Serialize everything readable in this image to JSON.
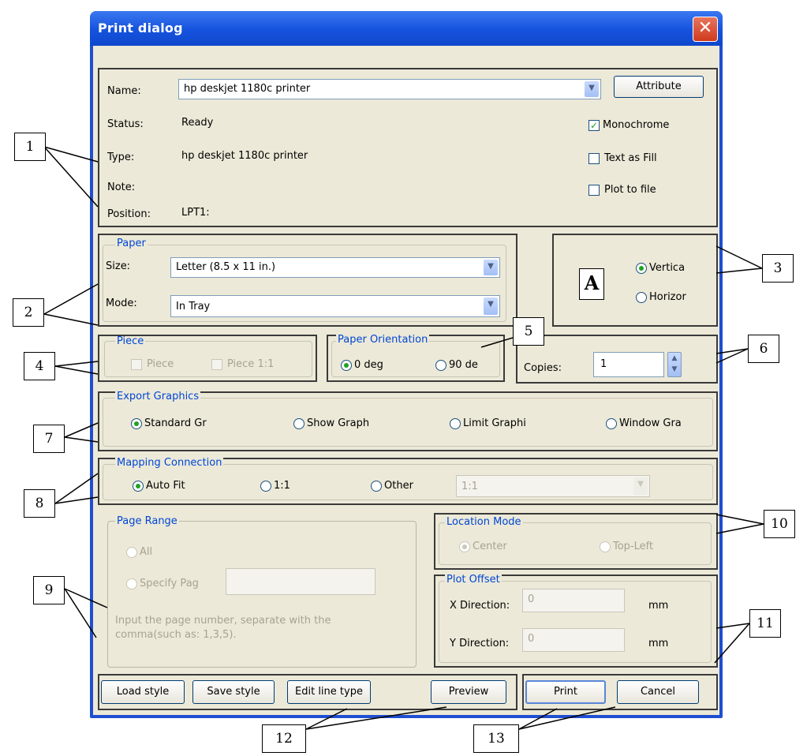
{
  "window": {
    "title": "Print dialog",
    "close_glyph": "✕"
  },
  "printer": {
    "name_label": "Name:",
    "name_value": "hp deskjet 1180c printer",
    "attribute_button": "Attribute",
    "status_label": "Status:",
    "status_value": "Ready",
    "type_label": "Type:",
    "type_value": "hp deskjet 1180c printer",
    "note_label": "Note:",
    "note_value": "",
    "position_label": "Position:",
    "position_value": "LPT1:",
    "monochrome": {
      "label": "Monochrome",
      "checked": true
    },
    "text_as_fill": {
      "label": "Text as Fill",
      "checked": false
    },
    "plot_to_file": {
      "label": "Plot to file",
      "checked": false
    }
  },
  "paper": {
    "legend": "Paper",
    "size_label": "Size:",
    "size_value": "Letter (8.5 x 11 in.)",
    "mode_label": "Mode:",
    "mode_value": "In Tray"
  },
  "orientation_preview": {
    "glyph": "A",
    "vertical": "Vertica",
    "horizontal": "Horizor",
    "selected": "vertical"
  },
  "piece": {
    "legend": "Piece",
    "piece_label": "Piece",
    "piece11_label": "Piece 1:1"
  },
  "paper_orientation": {
    "legend": "Paper Orientation",
    "deg0": "0 deg",
    "deg90": "90 de",
    "selected": "0 deg"
  },
  "copies": {
    "label": "Copies:",
    "value": "1"
  },
  "export_graphics": {
    "legend": "Export Graphics",
    "options": [
      "Standard Gr",
      "Show Graph",
      "Limit Graphi",
      "Window Gra"
    ],
    "selected": "Standard Gr"
  },
  "mapping": {
    "legend": "Mapping Connection",
    "auto_fit": "Auto Fit",
    "one_to_one": "1:1",
    "other": "Other",
    "other_value": "1:1",
    "selected": "Auto Fit"
  },
  "page_range": {
    "legend": "Page Range",
    "all": "All",
    "specify": "Specify Pag",
    "hint_line1": "Input the page number, separate with the",
    "hint_line2": "comma(such as: 1,3,5)."
  },
  "location_mode": {
    "legend": "Location Mode",
    "center": "Center",
    "top_left": "Top-Left",
    "selected": "Center"
  },
  "plot_offset": {
    "legend": "Plot Offset",
    "x_label": "X Direction:",
    "x_value": "0",
    "x_unit": "mm",
    "y_label": "Y Direction:",
    "y_value": "0",
    "y_unit": "mm"
  },
  "buttons": {
    "load_style": "Load style",
    "save_style": "Save style",
    "edit_line_type": "Edit line type",
    "preview": "Preview",
    "print": "Print",
    "cancel": "Cancel"
  },
  "callouts": [
    "1",
    "2",
    "3",
    "4",
    "5",
    "6",
    "7",
    "8",
    "9",
    "10",
    "11",
    "12",
    "13"
  ],
  "colors": {
    "title_bar": "#1552dd",
    "dialog_bg": "#ece9d8",
    "legend_text": "#0046d5",
    "check_green": "#21a121"
  }
}
